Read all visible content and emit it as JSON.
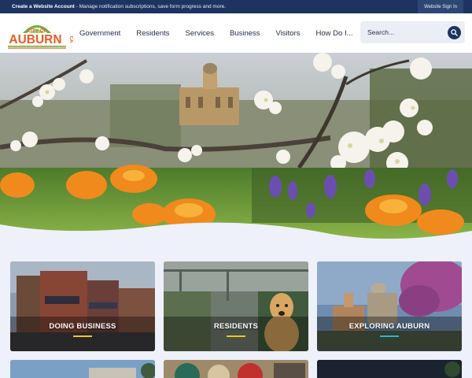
{
  "topbar": {
    "account_link": "Create a Website Account",
    "account_desc": " - Manage notification subscriptions, save form progress and more.",
    "signin_label": "Website Sign In"
  },
  "logo": {
    "line1": "CITY OF",
    "line2": "AUBURN",
    "side": "CA"
  },
  "nav": {
    "items": [
      "Government",
      "Residents",
      "Services",
      "Business",
      "Visitors",
      "How Do I..."
    ]
  },
  "search": {
    "placeholder": "Search..."
  },
  "tiles": [
    {
      "label": "DOING BUSINESS",
      "accent": "#f2c51b"
    },
    {
      "label": "RESIDENTS",
      "accent": "#f2c51b"
    },
    {
      "label": "EXPLORING AUBURN",
      "accent": "#2fb4c8"
    }
  ],
  "colors": {
    "navy": "#1d3461",
    "page_bg": "#eef0fa",
    "green": "#6ab33f",
    "orange": "#e65d25"
  },
  "icons": {
    "search": "magnifier-icon"
  }
}
